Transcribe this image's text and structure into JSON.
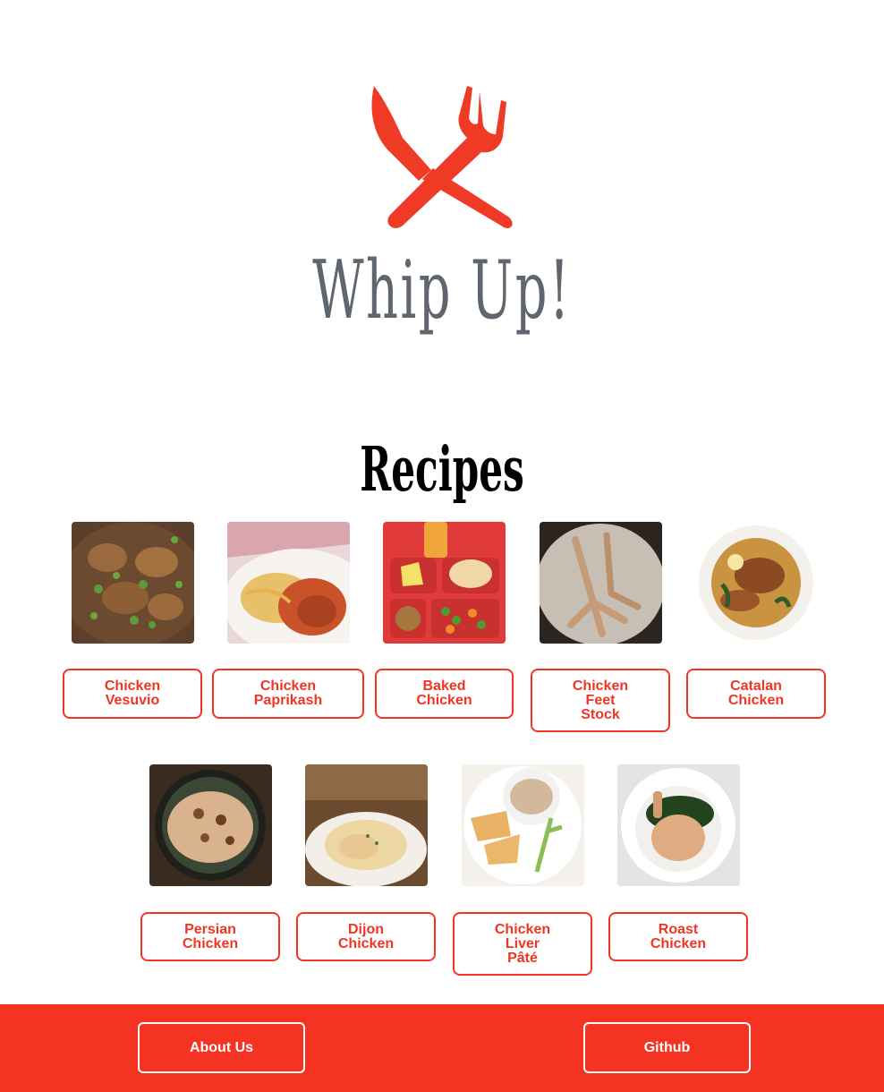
{
  "brand": {
    "logo_text": "Whip Up!",
    "accent_color": "#f53322",
    "logo_text_color": "#5f666d"
  },
  "recipes_heading": "Recipes",
  "recipes": [
    {
      "lines": [
        "Chicken",
        "Vesuvio"
      ]
    },
    {
      "lines": [
        "Chicken",
        "Paprikash"
      ]
    },
    {
      "lines": [
        "Baked",
        "Chicken"
      ]
    },
    {
      "lines": [
        "Chicken",
        "Feet",
        "Stock"
      ]
    },
    {
      "lines": [
        "Catalan",
        "Chicken"
      ]
    },
    {
      "lines": [
        "Persian",
        "Chicken"
      ]
    },
    {
      "lines": [
        "Dijon",
        "Chicken"
      ]
    },
    {
      "lines": [
        "Chicken",
        "Liver",
        "Pâté"
      ]
    },
    {
      "lines": [
        "Roast",
        "Chicken"
      ]
    }
  ],
  "footer": {
    "about_label": "About Us",
    "github_label": "Github"
  }
}
